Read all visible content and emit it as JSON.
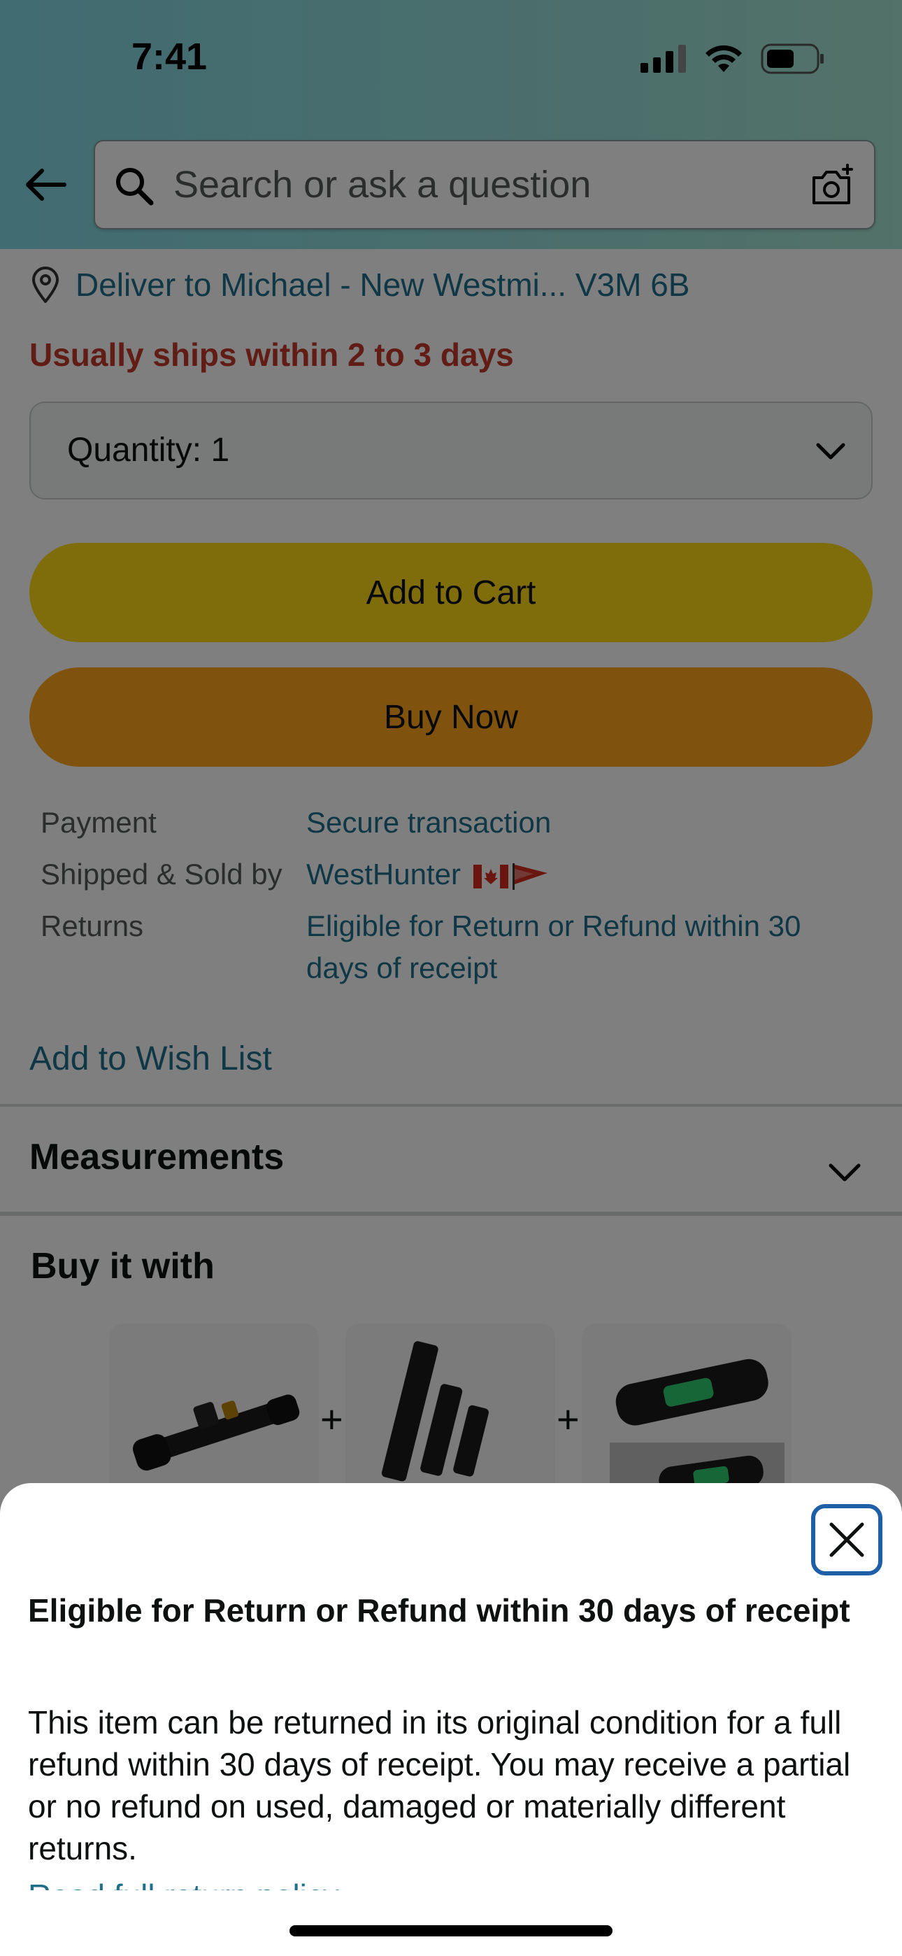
{
  "status_bar": {
    "time": "7:41"
  },
  "header": {
    "search_placeholder": "Search or ask a question"
  },
  "delivery": {
    "text": "Deliver to Michael - New Westmi... V3M 6B"
  },
  "shipping_notice": "Usually ships within 2 to 3 days",
  "quantity": {
    "label": "Quantity:",
    "value": "1"
  },
  "buttons": {
    "add_to_cart": "Add to Cart",
    "buy_now": "Buy Now"
  },
  "details": [
    {
      "label": "Payment",
      "value": "Secure transaction"
    },
    {
      "label": "Shipped & Sold by",
      "value": "WestHunter"
    },
    {
      "label": "Returns",
      "value": "Eligible for Return or Refund within 30 days of receipt"
    }
  ],
  "wish_list": "Add to Wish List",
  "measurements_heading": "Measurements",
  "buy_it_with_heading": "Buy it with",
  "sheet": {
    "title": "Eligible for Return or Refund within 30 days of receipt",
    "body": "This item can be returned in its original condition for a full refund within 30 days of receipt. You may receive a partial or no refund on used, damaged or materially different returns.",
    "link": "Read full return policy"
  },
  "colors": {
    "accent_link": "#1f6f8b",
    "cart_button": "#ffd814",
    "buy_button": "#ffa41c",
    "ships_red": "#c0392b",
    "close_border": "#1f5fa8"
  },
  "icons": [
    "back-arrow-icon",
    "search-icon",
    "camera-icon",
    "location-pin-icon",
    "chevron-down-icon",
    "close-icon",
    "canada-flag-icon",
    "pennant-flag-icon"
  ]
}
